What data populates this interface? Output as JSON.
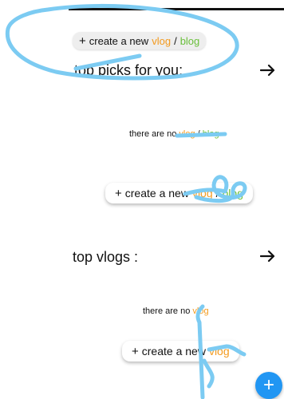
{
  "create_buttons": {
    "plus": "+",
    "prefix": "create a new",
    "word_vlog": "vlog",
    "separator": "/",
    "word_blog": "blog"
  },
  "top_picks": {
    "title": "top picks for you:",
    "empty_prefix": "there are no",
    "empty_vlog": "vlog",
    "empty_sep": "/",
    "empty_blog": "blog"
  },
  "top_vlogs": {
    "title": "top vlogs :",
    "empty_prefix": "there are no",
    "empty_vlog": "vlog"
  },
  "fab": {
    "label": "+"
  },
  "colors": {
    "vlog": "#f39a1e",
    "blog": "#6abf3b",
    "fab": "#2196f3",
    "scribble": "#7ccbf2"
  }
}
